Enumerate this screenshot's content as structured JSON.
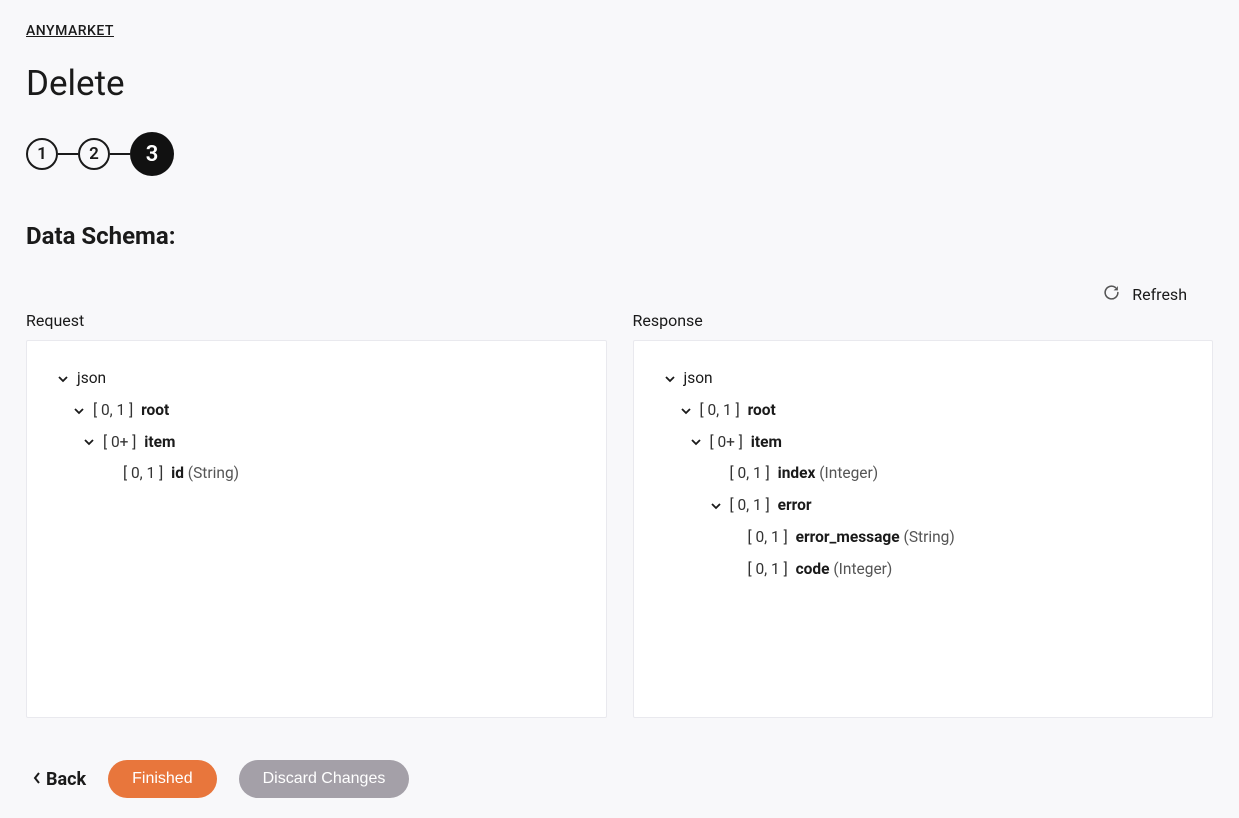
{
  "breadcrumb": "ANYMARKET",
  "page_title": "Delete",
  "stepper": {
    "steps": [
      "1",
      "2",
      "3"
    ],
    "active_index": 2
  },
  "section_title": "Data Schema:",
  "refresh_label": "Refresh",
  "panels": {
    "request": {
      "label": "Request",
      "tree": [
        {
          "indent": 0,
          "expandable": true,
          "text": "json"
        },
        {
          "indent": 1,
          "expandable": true,
          "card": "[ 0, 1 ]",
          "name": "root"
        },
        {
          "indent": 2,
          "expandable": true,
          "card": "[ 0+ ]",
          "name": "item"
        },
        {
          "indent": 3,
          "expandable": false,
          "card": "[ 0, 1 ]",
          "name": "id",
          "type": "(String)"
        }
      ]
    },
    "response": {
      "label": "Response",
      "tree": [
        {
          "indent": 0,
          "expandable": true,
          "text": "json"
        },
        {
          "indent": 1,
          "expandable": true,
          "card": "[ 0, 1 ]",
          "name": "root"
        },
        {
          "indent": 2,
          "expandable": true,
          "card": "[ 0+ ]",
          "name": "item"
        },
        {
          "indent": 3,
          "expandable": false,
          "card": "[ 0, 1 ]",
          "name": "index",
          "type": "(Integer)"
        },
        {
          "indent": 3,
          "expandable": true,
          "card": "[ 0, 1 ]",
          "name": "error"
        },
        {
          "indent": 4,
          "expandable": false,
          "card": "[ 0, 1 ]",
          "name": "error_message",
          "type": "(String)"
        },
        {
          "indent": 4,
          "expandable": false,
          "card": "[ 0, 1 ]",
          "name": "code",
          "type": "(Integer)"
        }
      ]
    }
  },
  "footer": {
    "back": "Back",
    "finished": "Finished",
    "discard": "Discard Changes"
  }
}
